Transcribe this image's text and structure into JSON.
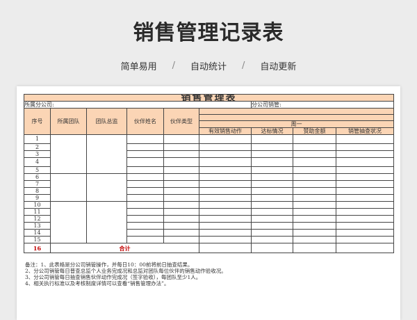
{
  "title": "销售管理记录表",
  "features": [
    "简单易用",
    "自动统计",
    "自动更新"
  ],
  "feature_separator": "/",
  "sheet": {
    "title": "销售管理表",
    "branch_label": "所属分公司:",
    "manager_label": "分公司销管:",
    "headers": {
      "seq": "序号",
      "team": "所属团队",
      "supervisor": "团队总监",
      "partner_name": "伙伴姓名",
      "partner_type": "伙伴类型",
      "week": "周一",
      "sub": [
        "有效销售动作",
        "达标情况",
        "赞助金额",
        "销管抽查状况"
      ]
    },
    "rows": [
      "1",
      "2",
      "3",
      "4",
      "5",
      "6",
      "7",
      "8",
      "9",
      "10",
      "11",
      "12",
      "13",
      "14",
      "15"
    ],
    "total_row": {
      "seq": "16",
      "label": "合计"
    },
    "notes": [
      "备注：1、此表格是分公司销管操作，并每日10：00前将前日抽查结果。",
      "2、分公司销管每日普查总监个人业务完成况和总监对团队每位伙伴的销售动作验收况。",
      "3、分公司销管每日抽查销售伙伴动作完成况（签字验收），每团队至少1人。",
      "4、相关执行标准以及考核制度详情可以查看“销售管理办法”。"
    ]
  }
}
